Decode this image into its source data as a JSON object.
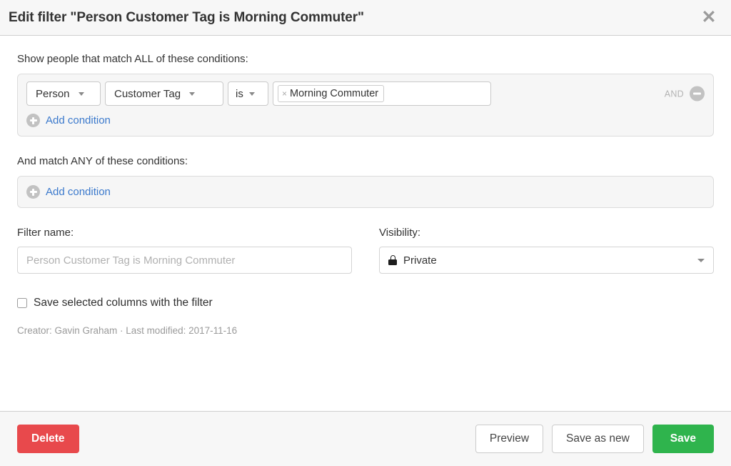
{
  "header": {
    "title": "Edit filter \"Person Customer Tag is Morning Commuter\"",
    "close_icon": "close-icon"
  },
  "all_section": {
    "label": "Show people that match ALL of these conditions:",
    "condition": {
      "subject": "Person",
      "attribute": "Customer Tag",
      "operator": "is",
      "tag_value": "Morning Commuter",
      "tag_remove_icon": "×",
      "join_label": "AND",
      "remove_icon": "minus-circle-icon"
    },
    "add_condition_label": "Add condition",
    "add_icon": "plus-circle-icon"
  },
  "any_section": {
    "label": "And match ANY of these conditions:",
    "add_condition_label": "Add condition",
    "add_icon": "plus-circle-icon"
  },
  "filter_name": {
    "label": "Filter name:",
    "value": "",
    "placeholder": "Person Customer Tag is Morning Commuter"
  },
  "visibility": {
    "label": "Visibility:",
    "selected": "Private",
    "icon": "lock-icon",
    "caret_icon": "chevron-down-icon"
  },
  "save_columns": {
    "label": "Save selected columns with the filter",
    "checked": false
  },
  "meta": {
    "text": "Creator: Gavin Graham · Last modified: 2017-11-16"
  },
  "footer": {
    "delete_label": "Delete",
    "preview_label": "Preview",
    "save_as_new_label": "Save as new",
    "save_label": "Save"
  },
  "colors": {
    "danger": "#e8494c",
    "success": "#2fb44d",
    "link": "#3b79cc",
    "panel_bg": "#f6f6f6",
    "chrome_bg": "#f7f7f7"
  }
}
